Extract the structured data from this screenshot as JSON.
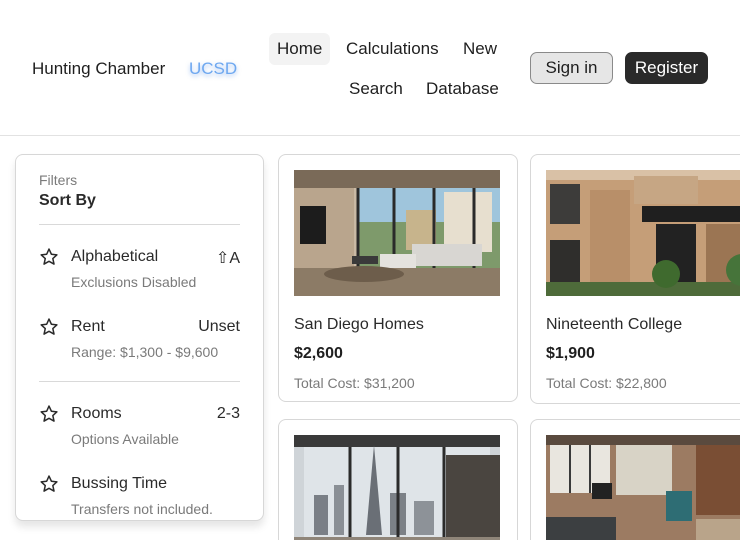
{
  "header": {
    "brand": "Hunting Chamber",
    "campus": "UCSD",
    "nav": [
      "Home",
      "Calculations",
      "New",
      "Search",
      "Database"
    ],
    "active_nav": "Home",
    "sign_in": "Sign in",
    "register": "Register"
  },
  "filters": {
    "caption": "Filters",
    "title": "Sort By",
    "items": [
      {
        "label": "Alphabetical",
        "value": "⇧A",
        "sub": "Exclusions Disabled",
        "icon": "star-icon"
      },
      {
        "label": "Rent",
        "value": "Unset",
        "sub": "Range: $1,300 - $9,600",
        "icon": "star-icon"
      },
      {
        "label": "Rooms",
        "value": "2-3",
        "sub": "Options Available",
        "icon": "star-icon"
      },
      {
        "label": "Bussing Time",
        "value": "",
        "sub": "Transfers not included.",
        "icon": "star-icon"
      }
    ]
  },
  "listings": [
    {
      "name": "San Diego Homes",
      "price": "$2,600",
      "total": "Total Cost: $31,200",
      "photo": "modern-living-room-photo"
    },
    {
      "name": "Nineteenth College",
      "price": "$1,900",
      "total": "Total Cost: $22,800",
      "photo": "apartment-building-exterior-photo"
    },
    {
      "name": "",
      "price": "",
      "total": "",
      "photo": "city-view-loft-photo"
    },
    {
      "name": "",
      "price": "",
      "total": "",
      "photo": "studio-apartment-interior-photo"
    }
  ],
  "colors": {
    "accent_link": "#6ea8f0",
    "register_bg": "#2a2a2a",
    "signin_bg": "#e6e6e6",
    "muted_text": "#7a7a7a"
  }
}
